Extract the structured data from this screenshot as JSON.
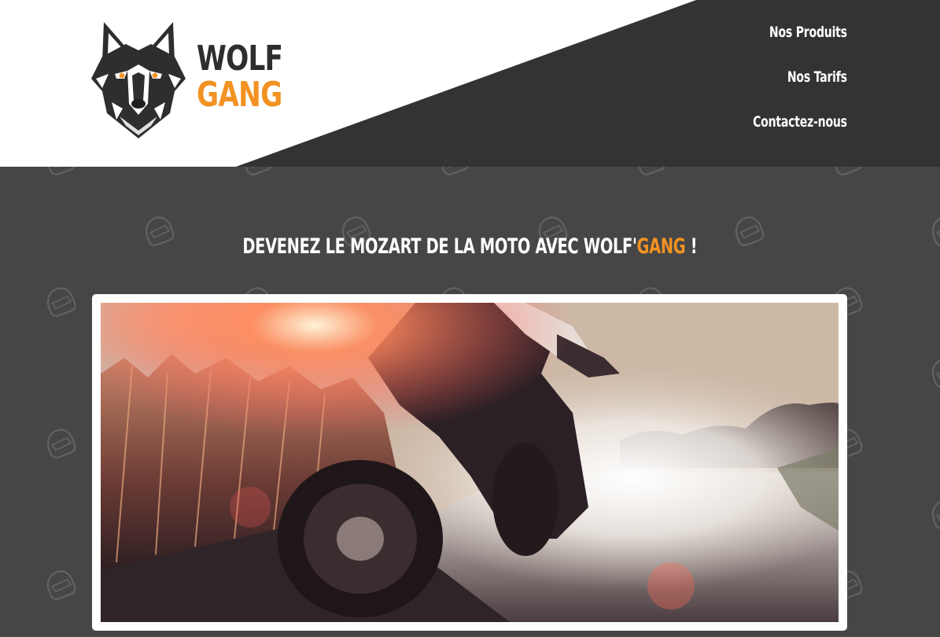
{
  "brand": {
    "name_line1": "WOLF",
    "name_line2": "GANG",
    "logo_icon": "wolf-head-icon",
    "colors": {
      "dark": "#2e2e2e",
      "accent": "#f29222"
    }
  },
  "nav": {
    "items": [
      {
        "label": "Nos Produits"
      },
      {
        "label": "Nos Tarifs"
      },
      {
        "label": "Contactez-nous"
      }
    ]
  },
  "hero": {
    "headline_prefix": "DEVENEZ LE MOZART DE LA MOTO AVEC WOLF'",
    "headline_accent": "GANG",
    "headline_suffix": " !",
    "image": "motorcycle-night-road-photo"
  },
  "theme": {
    "background": "#464646",
    "header_dark": "#333333",
    "pattern_icon": "helmet-icon"
  }
}
